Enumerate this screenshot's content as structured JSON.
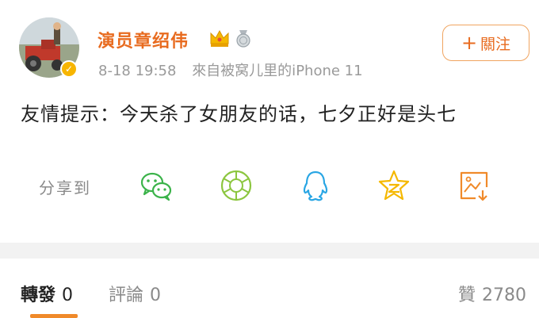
{
  "post": {
    "username": "演员章绍伟",
    "time": "8-18 19:58",
    "source": "來自被窝儿里的iPhone 11",
    "content": "友情提示：今天杀了女朋友的话，七夕正好是头七",
    "follow": {
      "plus": "+",
      "label": "關注"
    }
  },
  "share": {
    "label": "分享到",
    "icons": [
      "wechat-icon",
      "moments-icon",
      "qq-icon",
      "qzone-icon",
      "save-image-icon"
    ]
  },
  "tabs": {
    "repost": {
      "label": "轉發",
      "count": "0"
    },
    "comment": {
      "label": "評論",
      "count": "0"
    },
    "like": {
      "label": "贊",
      "count": "2780"
    }
  },
  "colors": {
    "username": "#e86b1f",
    "accent": "#f08a2a",
    "wechat": "#3bb34a",
    "moments": "#8cc63f",
    "qq": "#2aa6e4",
    "qzone": "#f5b800",
    "save": "#f08a2a",
    "muted": "#9a9a9a"
  }
}
